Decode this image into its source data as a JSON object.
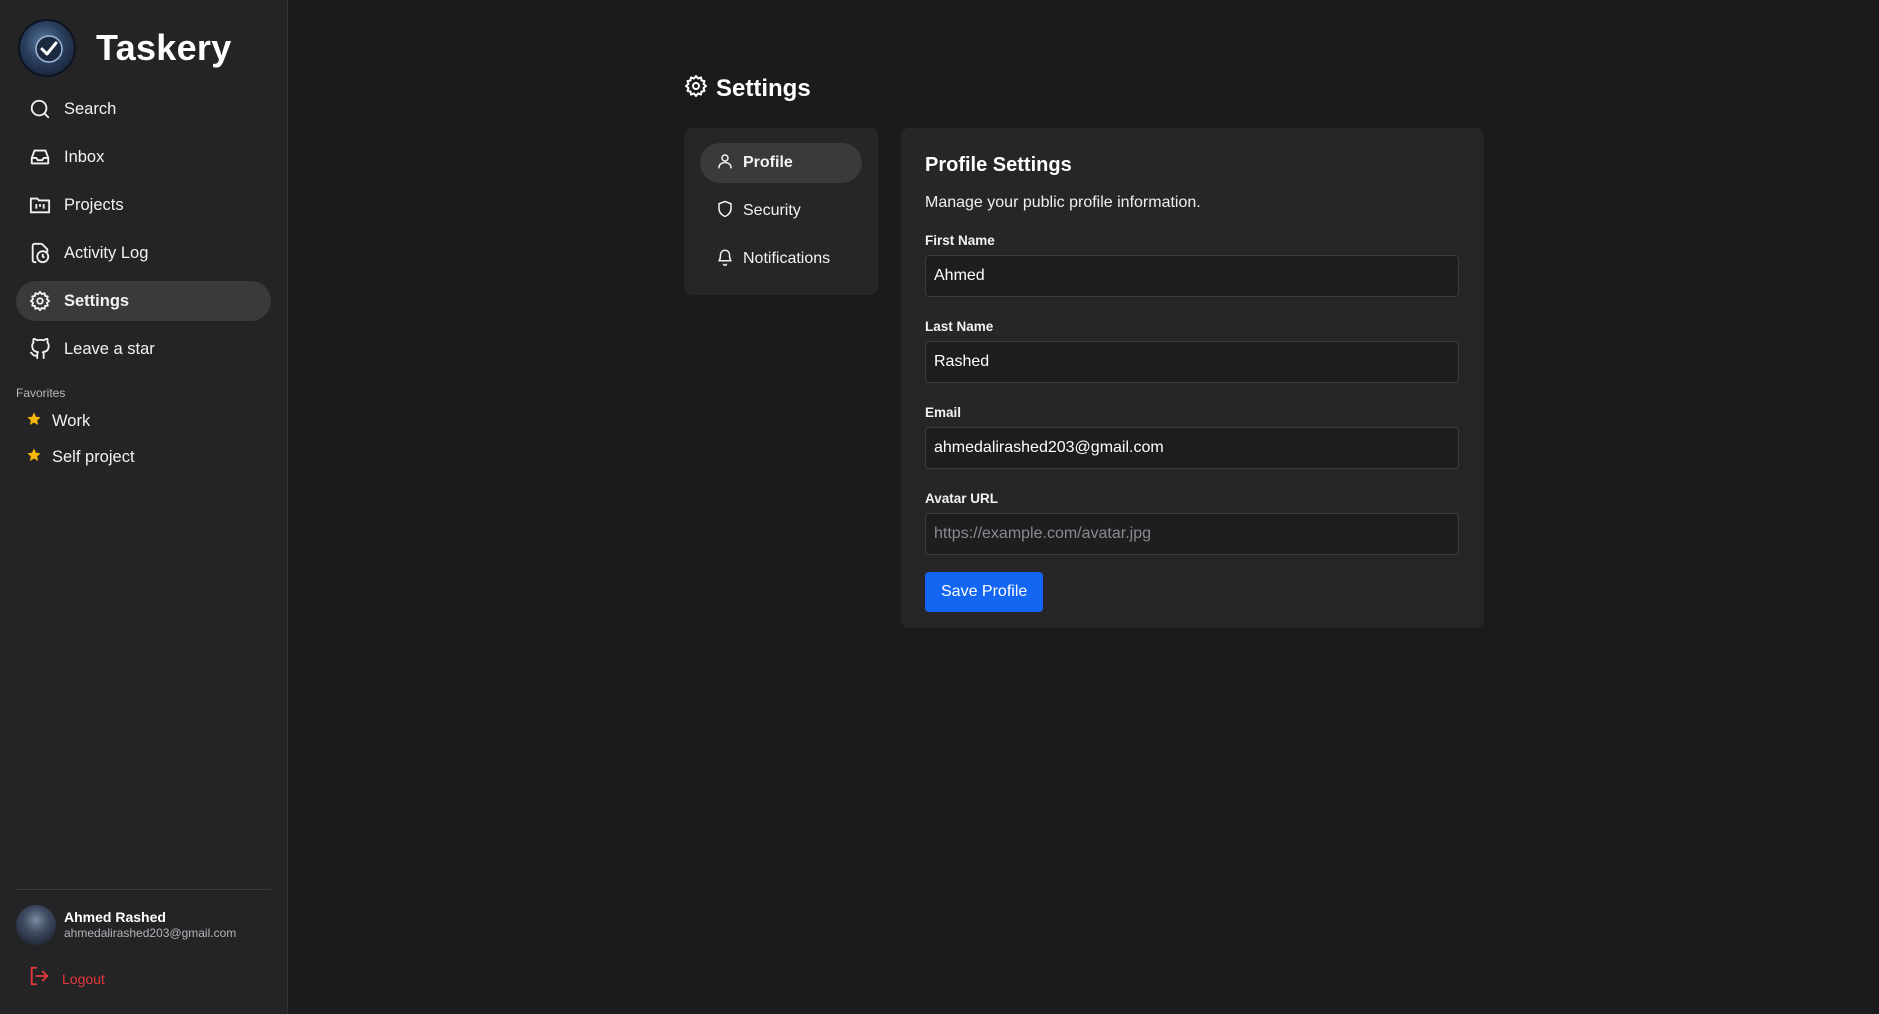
{
  "app": {
    "name": "Taskery"
  },
  "sidebar": {
    "nav": [
      {
        "label": "Search",
        "icon": "search-icon"
      },
      {
        "label": "Inbox",
        "icon": "inbox-icon"
      },
      {
        "label": "Projects",
        "icon": "projects-icon"
      },
      {
        "label": "Activity Log",
        "icon": "activity-log-icon"
      },
      {
        "label": "Settings",
        "icon": "gear-icon",
        "active": true
      },
      {
        "label": "Leave a star",
        "icon": "github-icon"
      }
    ],
    "favorites_title": "Favorites",
    "favorites": [
      {
        "label": "Work",
        "icon": "star-icon"
      },
      {
        "label": "Self project",
        "icon": "star-icon"
      }
    ],
    "user": {
      "name": "Ahmed Rashed",
      "email": "ahmedalirashed203@gmail.com"
    },
    "logout_label": "Logout"
  },
  "page": {
    "title": "Settings"
  },
  "settings_tabs": [
    {
      "label": "Profile",
      "icon": "user-icon",
      "active": true
    },
    {
      "label": "Security",
      "icon": "shield-icon"
    },
    {
      "label": "Notifications",
      "icon": "bell-icon"
    }
  ],
  "profile": {
    "title": "Profile Settings",
    "subtitle": "Manage your public profile information.",
    "first_name": {
      "label": "First Name",
      "value": "Ahmed"
    },
    "last_name": {
      "label": "Last Name",
      "value": "Rashed"
    },
    "email": {
      "label": "Email",
      "value": "ahmedalirashed203@gmail.com"
    },
    "avatar_url": {
      "label": "Avatar URL",
      "value": "",
      "placeholder": "https://example.com/avatar.jpg"
    },
    "save_label": "Save Profile"
  },
  "colors": {
    "accent": "#1266f1",
    "danger": "#e5383b",
    "star": "#f5b50a",
    "background": "#1b1b1d",
    "sidebar": "#242426"
  }
}
